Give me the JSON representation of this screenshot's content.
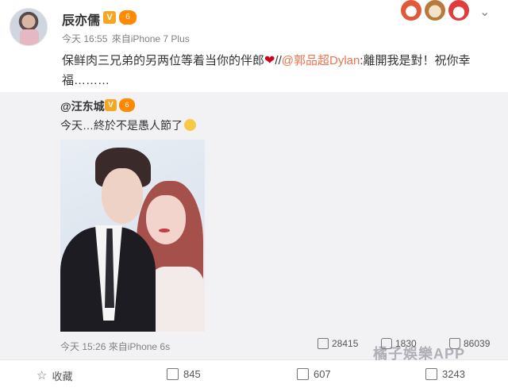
{
  "post": {
    "username": "辰亦儒",
    "verified_badge": "V",
    "level_badge": "6",
    "time": "今天 16:55",
    "source": "來自iPhone 7 Plus",
    "content_main": "保鲜肉三兄弟的另两位等着当你的伴郎",
    "content_sep": "//",
    "mention": "@郭品超Dylan",
    "content_tail": ":離開我是對！祝你幸福………",
    "heart_icon": "heart-icon"
  },
  "repost": {
    "username": "@汪东城",
    "verified_badge": "V",
    "level_badge": "6",
    "text": "今天…終於不是愚人節了",
    "time": "今天 15:26",
    "source": "來自iPhone 6s",
    "reposts": "28415",
    "comments": "1830",
    "likes": "86039"
  },
  "actions": {
    "favorite": "收藏",
    "repost": "845",
    "comment": "607",
    "like": "3243"
  },
  "watermark": "橘子娛樂APP",
  "colors": {
    "accent_orange": "#eb7350",
    "repost_bg": "#f2f2f5",
    "heart": "#d0021b"
  }
}
